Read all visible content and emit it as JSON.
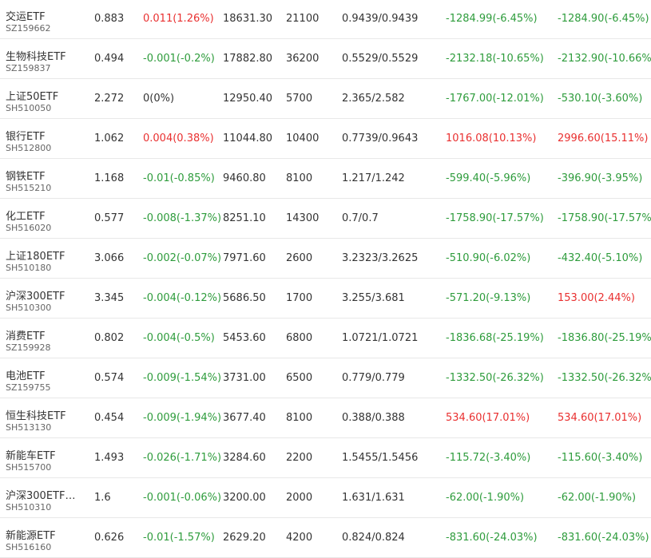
{
  "colors": {
    "up": "#e93030",
    "down": "#2e9c3c",
    "flat": "#333333"
  },
  "holdings": [
    {
      "name": "交运ETF",
      "code": "SZ159662",
      "price": "0.883",
      "change": "0.011(1.26%)",
      "change_dir": "up",
      "market_value": "18631.30",
      "shares": "21100",
      "cost": "0.9439/0.9439",
      "pl1": "-1284.99(-6.45%)",
      "pl1_dir": "down",
      "pl2": "-1284.90(-6.45%)",
      "pl2_dir": "down"
    },
    {
      "name": "生物科技ETF",
      "code": "SZ159837",
      "price": "0.494",
      "change": "-0.001(-0.2%)",
      "change_dir": "down",
      "market_value": "17882.80",
      "shares": "36200",
      "cost": "0.5529/0.5529",
      "pl1": "-2132.18(-10.65%)",
      "pl1_dir": "down",
      "pl2": "-2132.90(-10.66%)",
      "pl2_dir": "down"
    },
    {
      "name": "上证50ETF",
      "code": "SH510050",
      "price": "2.272",
      "change": "0(0%)",
      "change_dir": "flat",
      "market_value": "12950.40",
      "shares": "5700",
      "cost": "2.365/2.582",
      "pl1": "-1767.00(-12.01%)",
      "pl1_dir": "down",
      "pl2": "-530.10(-3.60%)",
      "pl2_dir": "down"
    },
    {
      "name": "银行ETF",
      "code": "SH512800",
      "price": "1.062",
      "change": "0.004(0.38%)",
      "change_dir": "up",
      "market_value": "11044.80",
      "shares": "10400",
      "cost": "0.7739/0.9643",
      "pl1": "1016.08(10.13%)",
      "pl1_dir": "up",
      "pl2": "2996.60(15.11%)",
      "pl2_dir": "up"
    },
    {
      "name": "钢铁ETF",
      "code": "SH515210",
      "price": "1.168",
      "change": "-0.01(-0.85%)",
      "change_dir": "down",
      "market_value": "9460.80",
      "shares": "8100",
      "cost": "1.217/1.242",
      "pl1": "-599.40(-5.96%)",
      "pl1_dir": "down",
      "pl2": "-396.90(-3.95%)",
      "pl2_dir": "down"
    },
    {
      "name": "化工ETF",
      "code": "SH516020",
      "price": "0.577",
      "change": "-0.008(-1.37%)",
      "change_dir": "down",
      "market_value": "8251.10",
      "shares": "14300",
      "cost": "0.7/0.7",
      "pl1": "-1758.90(-17.57%)",
      "pl1_dir": "down",
      "pl2": "-1758.90(-17.57%)",
      "pl2_dir": "down"
    },
    {
      "name": "上证180ETF",
      "code": "SH510180",
      "price": "3.066",
      "change": "-0.002(-0.07%)",
      "change_dir": "down",
      "market_value": "7971.60",
      "shares": "2600",
      "cost": "3.2323/3.2625",
      "pl1": "-510.90(-6.02%)",
      "pl1_dir": "down",
      "pl2": "-432.40(-5.10%)",
      "pl2_dir": "down"
    },
    {
      "name": "沪深300ETF",
      "code": "SH510300",
      "price": "3.345",
      "change": "-0.004(-0.12%)",
      "change_dir": "down",
      "market_value": "5686.50",
      "shares": "1700",
      "cost": "3.255/3.681",
      "pl1": "-571.20(-9.13%)",
      "pl1_dir": "down",
      "pl2": "153.00(2.44%)",
      "pl2_dir": "up"
    },
    {
      "name": "消费ETF",
      "code": "SZ159928",
      "price": "0.802",
      "change": "-0.004(-0.5%)",
      "change_dir": "down",
      "market_value": "5453.60",
      "shares": "6800",
      "cost": "1.0721/1.0721",
      "pl1": "-1836.68(-25.19%)",
      "pl1_dir": "down",
      "pl2": "-1836.80(-25.19%)",
      "pl2_dir": "down"
    },
    {
      "name": "电池ETF",
      "code": "SZ159755",
      "price": "0.574",
      "change": "-0.009(-1.54%)",
      "change_dir": "down",
      "market_value": "3731.00",
      "shares": "6500",
      "cost": "0.779/0.779",
      "pl1": "-1332.50(-26.32%)",
      "pl1_dir": "down",
      "pl2": "-1332.50(-26.32%)",
      "pl2_dir": "down"
    },
    {
      "name": "恒生科技ETF",
      "code": "SH513130",
      "price": "0.454",
      "change": "-0.009(-1.94%)",
      "change_dir": "down",
      "market_value": "3677.40",
      "shares": "8100",
      "cost": "0.388/0.388",
      "pl1": "534.60(17.01%)",
      "pl1_dir": "up",
      "pl2": "534.60(17.01%)",
      "pl2_dir": "up"
    },
    {
      "name": "新能车ETF",
      "code": "SH515700",
      "price": "1.493",
      "change": "-0.026(-1.71%)",
      "change_dir": "down",
      "market_value": "3284.60",
      "shares": "2200",
      "cost": "1.5455/1.5456",
      "pl1": "-115.72(-3.40%)",
      "pl1_dir": "down",
      "pl2": "-115.60(-3.40%)",
      "pl2_dir": "down"
    },
    {
      "name": "沪深300ETF…",
      "code": "SH510310",
      "price": "1.6",
      "change": "-0.001(-0.06%)",
      "change_dir": "down",
      "market_value": "3200.00",
      "shares": "2000",
      "cost": "1.631/1.631",
      "pl1": "-62.00(-1.90%)",
      "pl1_dir": "down",
      "pl2": "-62.00(-1.90%)",
      "pl2_dir": "down"
    },
    {
      "name": "新能源ETF",
      "code": "SH516160",
      "price": "0.626",
      "change": "-0.01(-1.57%)",
      "change_dir": "down",
      "market_value": "2629.20",
      "shares": "4200",
      "cost": "0.824/0.824",
      "pl1": "-831.60(-24.03%)",
      "pl1_dir": "down",
      "pl2": "-831.60(-24.03%)",
      "pl2_dir": "down"
    }
  ]
}
